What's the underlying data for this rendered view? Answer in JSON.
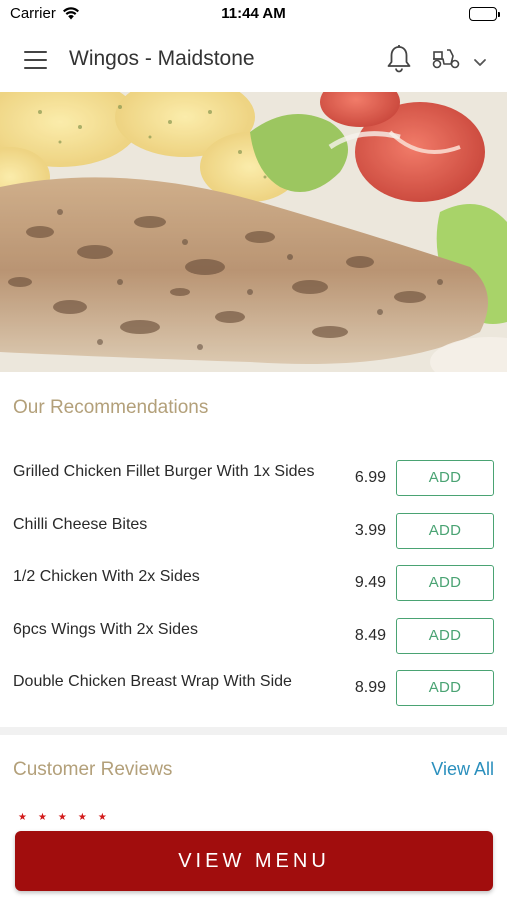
{
  "status_bar": {
    "carrier": "Carrier",
    "time": "11:44 AM"
  },
  "header": {
    "title": "Wingos - Maidstone",
    "icons": [
      "menu-icon",
      "bell-icon",
      "scooter-icon",
      "chevron-down-icon"
    ]
  },
  "hero": {
    "image": "grilled chicken fillet with salad"
  },
  "recommendations": {
    "title": "Our Recommendations",
    "add_label": "ADD",
    "items": [
      {
        "name": "Grilled Chicken Fillet Burger With 1x Sides",
        "price": "6.99"
      },
      {
        "name": "Chilli Cheese Bites",
        "price": "3.99"
      },
      {
        "name": "1/2 Chicken With 2x Sides",
        "price": "9.49"
      },
      {
        "name": "6pcs Wings With 2x Sides",
        "price": "8.49"
      },
      {
        "name": "Double Chicken Breast Wrap With Side",
        "price": "8.99"
      }
    ]
  },
  "reviews": {
    "title": "Customer Reviews",
    "view_all": "View All",
    "stars": "★★★★★"
  },
  "cta": {
    "label": "VIEW MENU"
  },
  "colors": {
    "accent_gold": "#b3a07a",
    "add_green": "#4aa373",
    "link_blue": "#2a8fbd",
    "cta_red": "#a10d0d",
    "star_red": "#d21b1b"
  }
}
